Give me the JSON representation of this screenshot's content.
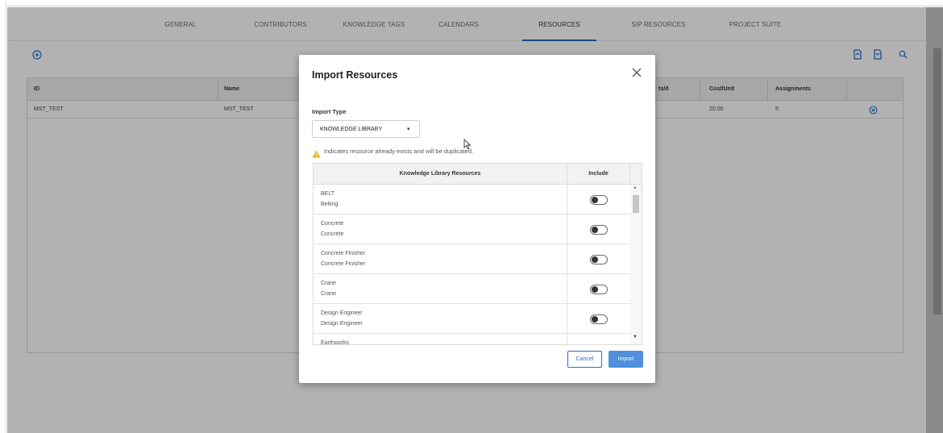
{
  "tabs": [
    {
      "label": "GENERAL",
      "active": false
    },
    {
      "label": "CONTRIBUTORS",
      "active": false
    },
    {
      "label": "KNOWLEDGE TAGS",
      "active": false
    },
    {
      "label": "CALENDARS",
      "active": false
    },
    {
      "label": "RESOURCES",
      "active": true
    },
    {
      "label": "SIP RESOURCES",
      "active": false
    },
    {
      "label": "PROJECT SUITE",
      "active": false
    }
  ],
  "toolbar": {
    "add_icon": "add-circle-icon",
    "export_icon": "export-icon",
    "import_icon": "import-icon",
    "search_icon": "search-icon"
  },
  "grid": {
    "headers": {
      "id": "ID",
      "name": "Name",
      "units": "ts/d",
      "cost": "Cost/Unit",
      "assignments": "Assignments"
    },
    "row": {
      "id": "MST_TEST",
      "name": "MST_TEST",
      "cost": "20.00",
      "assignments": "6",
      "action_icon": "remove-circle-icon"
    }
  },
  "modal": {
    "title": "Import Resources",
    "close_icon": "close-icon",
    "import_type_label": "Import Type",
    "import_type_value": "KNOWLEDGE LIBRARY",
    "import_type_caret": "▾",
    "warning_icon": "warning-icon",
    "warning_text": "Indicates resource already exists and will be duplicated.",
    "table": {
      "header_name": "Knowledge Library Resources",
      "header_include": "Include",
      "rows": [
        {
          "id": "BELT",
          "desc": "Belting",
          "include": false
        },
        {
          "id": "Concrete",
          "desc": "Concrete",
          "include": false
        },
        {
          "id": "Concrete Finisher",
          "desc": "Concrete Finisher",
          "include": false
        },
        {
          "id": "Crane",
          "desc": "Crane",
          "include": false
        },
        {
          "id": "Design Engineer",
          "desc": "Design Engineer",
          "include": false
        },
        {
          "id": "Earthworks",
          "desc": "",
          "include": false
        }
      ]
    },
    "cancel_label": "Cancel",
    "import_label": "Import"
  },
  "colors": {
    "accent": "#2a6bcc",
    "primary_button": "#4f8fdb",
    "warning": "#f5b400"
  }
}
